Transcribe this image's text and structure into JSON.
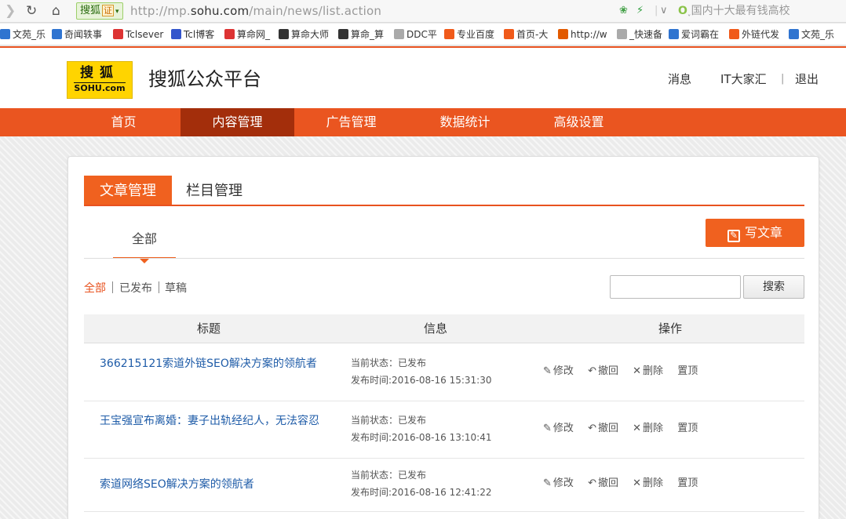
{
  "browser": {
    "secure_label": "搜狐",
    "cert_label": "证",
    "url_host_prefix": "http://mp.",
    "url_host_bold": "sohu.com",
    "url_path": "/main/news/list.action",
    "search_hint": "国内十大最有钱高校"
  },
  "bookmarks": [
    {
      "label": "文苑_乐",
      "color": "#2f74d0"
    },
    {
      "label": "奇闻轶事",
      "color": "#2f74d0"
    },
    {
      "label": "Tclsever",
      "color": "#d33"
    },
    {
      "label": "Tcl博客",
      "color": "#3355cc"
    },
    {
      "label": "算命网_",
      "color": "#d33"
    },
    {
      "label": "算命大师",
      "color": "#333"
    },
    {
      "label": "算命_算",
      "color": "#333"
    },
    {
      "label": "DDC平",
      "color": "#aaa"
    },
    {
      "label": "专业百度",
      "color": "#f05a1a"
    },
    {
      "label": "首页-大",
      "color": "#f05a1a"
    },
    {
      "label": "http://w",
      "color": "#e25a00"
    },
    {
      "label": "_快速备",
      "color": "#aaa"
    },
    {
      "label": "爱词霸在",
      "color": "#2f74d0"
    },
    {
      "label": "外链代发",
      "color": "#f05a1a"
    },
    {
      "label": "文苑_乐",
      "color": "#2f74d0"
    }
  ],
  "site": {
    "logo_top": "搜狐",
    "logo_bottom": "SOHU.com",
    "title": "搜狐公众平台",
    "links": {
      "messages": "消息",
      "user": "IT大家汇",
      "logout": "退出"
    },
    "separator": "|"
  },
  "nav": [
    "首页",
    "内容管理",
    "广告管理",
    "数据统计",
    "高级设置"
  ],
  "tabs": {
    "articles": "文章管理",
    "columns": "栏目管理"
  },
  "sub_tab": "全部",
  "write_button": "写文章",
  "filters": {
    "all": "全部",
    "published": "已发布",
    "draft": "草稿"
  },
  "search": {
    "button": "搜索",
    "value": ""
  },
  "table": {
    "headers": {
      "title": "标题",
      "info": "信息",
      "ops": "操作"
    },
    "ops_labels": {
      "edit": "修改",
      "withdraw": "撤回",
      "delete": "删除",
      "pin": "置顶"
    },
    "rows": [
      {
        "title": "366215121索道外链SEO解决方案的领航者",
        "status": "当前状态：已发布",
        "time": "发布时间:2016-08-16 15:31:30"
      },
      {
        "title": "王宝强宣布离婚：妻子出轨经纪人，无法容忍",
        "status": "当前状态：已发布",
        "time": "发布时间:2016-08-16 13:10:41"
      },
      {
        "title": "索道网络SEO解决方案的领航者",
        "status": "当前状态：已发布",
        "time": "发布时间:2016-08-16 12:41:22"
      }
    ]
  }
}
